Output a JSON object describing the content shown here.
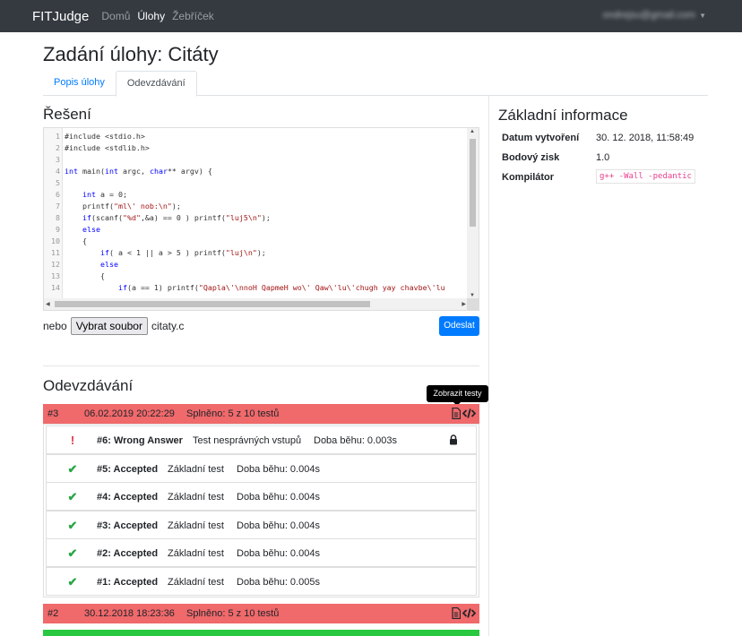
{
  "navbar": {
    "brand": "FITJudge",
    "links": [
      {
        "label": "Domů",
        "active": false
      },
      {
        "label": "Úlohy",
        "active": true
      },
      {
        "label": "Žebříček",
        "active": false
      }
    ],
    "user_email": "ondrejsu@gmail.com"
  },
  "page": {
    "title": "Zadání úlohy: Citáty"
  },
  "tabs": [
    {
      "label": "Popis úlohy",
      "active": false
    },
    {
      "label": "Odevzdávání",
      "active": true
    }
  ],
  "solution": {
    "heading": "Řešení",
    "code_lines": [
      {
        "n": "1",
        "text": "#include <stdio.h>"
      },
      {
        "n": "2",
        "text": "#include <stdlib.h>"
      },
      {
        "n": "3",
        "text": ""
      },
      {
        "n": "4",
        "text": "int main(int argc, char** argv) {"
      },
      {
        "n": "5",
        "text": ""
      },
      {
        "n": "6",
        "text": "    int a = 0;"
      },
      {
        "n": "7",
        "text": "    printf(\"ml\\' nob:\\n\");"
      },
      {
        "n": "8",
        "text": "    if(scanf(\"%d\",&a) == 0 ) printf(\"luj5\\n\");"
      },
      {
        "n": "9",
        "text": "    else"
      },
      {
        "n": "10",
        "text": "    {"
      },
      {
        "n": "11",
        "text": "        if( a < 1 || a > 5 ) printf(\"luj\\n\");"
      },
      {
        "n": "12",
        "text": "        else"
      },
      {
        "n": "13",
        "text": "        {"
      },
      {
        "n": "14",
        "text": "            if(a == 1) printf(\"Qapla\\'\\nnoH QapmeH wo\\' Qaw\\'lu\\'chugh yay chavbe\\'lu"
      }
    ],
    "file_prefix": "nebo",
    "file_button": "Vybrat soubor",
    "file_name": "citaty.c",
    "submit_label": "Odeslat"
  },
  "submissions": {
    "heading": "Odevzdávání",
    "tooltip": "Zobrazit testy",
    "items": [
      {
        "num": "#3",
        "date": "06.02.2019 20:22:29",
        "score": "Splněno: 5 z 10 testů",
        "status": "fail"
      },
      {
        "num": "#2",
        "date": "30.12.2018 18:23:36",
        "score": "Splněno: 5 z 10 testů",
        "status": "fail"
      },
      {
        "num": "",
        "date": "",
        "score": "",
        "status": "ok"
      }
    ],
    "tests": [
      {
        "status": "fail",
        "icon": "!",
        "name": "#6: Wrong Answer",
        "desc": "Test nesprávných vstupů",
        "time": "Doba běhu: 0.003s",
        "locked": true
      },
      {
        "status": "ok",
        "icon": "✔",
        "name": "#5: Accepted",
        "desc": "Základní test",
        "time": "Doba běhu: 0.004s",
        "locked": false
      },
      {
        "status": "ok",
        "icon": "✔",
        "name": "#4: Accepted",
        "desc": "Základní test",
        "time": "Doba běhu: 0.004s",
        "locked": false
      },
      {
        "status": "ok",
        "icon": "✔",
        "name": "#3: Accepted",
        "desc": "Základní test",
        "time": "Doba běhu: 0.004s",
        "locked": false
      },
      {
        "status": "ok",
        "icon": "✔",
        "name": "#2: Accepted",
        "desc": "Základní test",
        "time": "Doba běhu: 0.004s",
        "locked": false
      },
      {
        "status": "ok",
        "icon": "✔",
        "name": "#1: Accepted",
        "desc": "Základní test",
        "time": "Doba běhu: 0.005s",
        "locked": false
      }
    ]
  },
  "info": {
    "heading": "Základní informace",
    "rows": [
      {
        "label": "Datum vytvoření",
        "value": "30. 12. 2018, 11:58:49"
      },
      {
        "label": "Bodový zisk",
        "value": "1.0"
      },
      {
        "label": "Kompilátor",
        "value": "g++ -Wall -pedantic"
      }
    ]
  },
  "colors": {
    "navbar": "#343a40",
    "fail": "#f0696b",
    "ok": "#28c940",
    "primary": "#007bff"
  }
}
